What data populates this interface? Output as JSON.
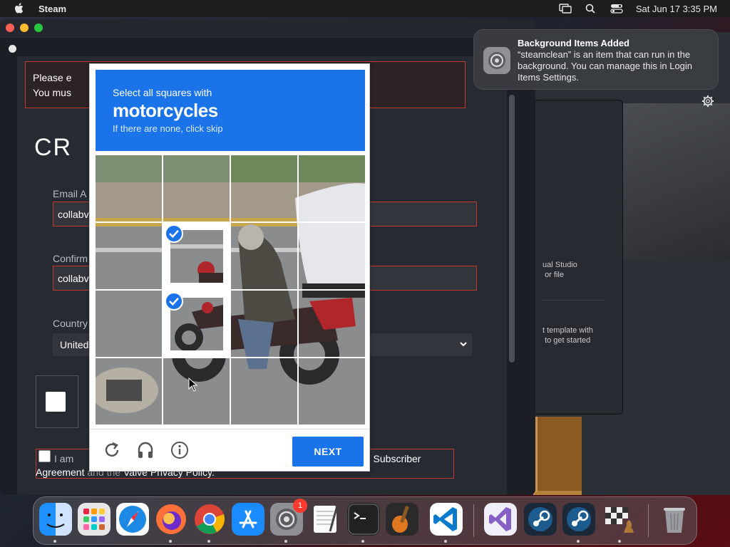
{
  "menubar": {
    "app_name": "Steam",
    "datetime": "Sat Jun 17  3:35 PM",
    "icons": [
      "apple-icon",
      "screen-mirror-icon",
      "spotlight-icon",
      "control-center-icon"
    ]
  },
  "main_window": {
    "error_line1": "Please e",
    "error_line2": "You mus",
    "title": "CR",
    "email_label": "Email A",
    "email_value": "collabv",
    "confirm_label": "Confirm",
    "confirm_value": "collabv",
    "country_label": "Country",
    "country_value": "United",
    "agree_prefix": "I am",
    "agree_subscriber": "m Subscriber",
    "agree_line2_a": "Agreement",
    "agree_line2_b": "and the",
    "agree_line2_c": "Valve Privacy Policy."
  },
  "captcha": {
    "instruction": "Select all squares with",
    "target": "motorcycles",
    "hint": "If there are none, click skip",
    "next_label": "NEXT",
    "selected_cells": [
      5,
      9
    ],
    "footer_icons": [
      "reload-icon",
      "audio-icon",
      "info-icon"
    ]
  },
  "notification": {
    "title": "Background Items Added",
    "body": "“steamclean” is an item that can run in the background. You can manage this in Login Items Settings."
  },
  "back_window": {
    "text1_l1": "ual Studio",
    "text1_l2": "or file",
    "text2_l1": "t template with",
    "text2_l2": "to get started"
  },
  "dock": {
    "apps": [
      "Finder",
      "Launchpad",
      "Safari",
      "Firefox",
      "Chrome",
      "App Store",
      "System Settings",
      "TextEdit",
      "Terminal",
      "GarageBand",
      "Visual Studio Code",
      "Visual Studio",
      "Steam",
      "Steam",
      "Chess",
      "Trash"
    ],
    "settings_badge": "1"
  }
}
